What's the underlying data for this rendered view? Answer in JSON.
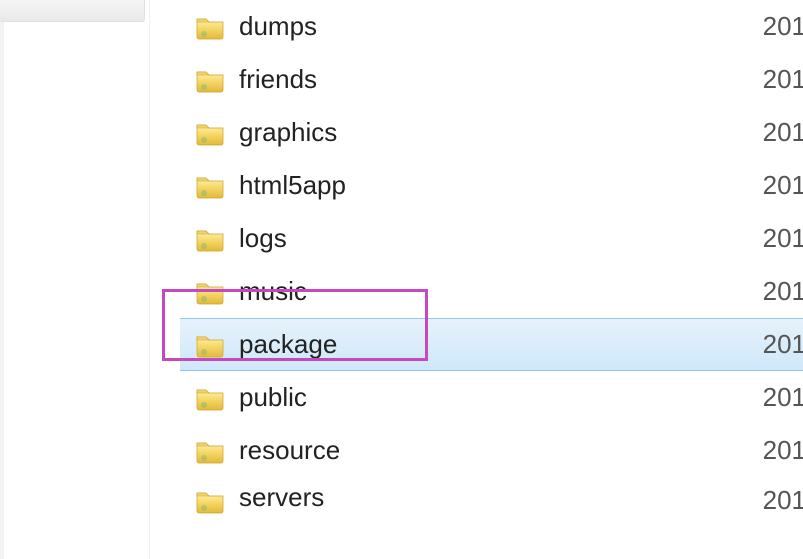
{
  "selected_index": 6,
  "highlight_color": "#c648c1",
  "selection_color": "#cfe8f9",
  "items": [
    {
      "name": "dumps",
      "date": "201",
      "type": "folder"
    },
    {
      "name": "friends",
      "date": "201",
      "type": "folder"
    },
    {
      "name": "graphics",
      "date": "201",
      "type": "folder"
    },
    {
      "name": "html5app",
      "date": "201",
      "type": "folder"
    },
    {
      "name": "logs",
      "date": "201",
      "type": "folder"
    },
    {
      "name": "music",
      "date": "201",
      "type": "folder"
    },
    {
      "name": "package",
      "date": "201",
      "type": "folder",
      "selected": true
    },
    {
      "name": "public",
      "date": "201",
      "type": "folder"
    },
    {
      "name": "resource",
      "date": "201",
      "type": "folder"
    },
    {
      "name": "servers",
      "date": "201",
      "type": "folder"
    }
  ]
}
